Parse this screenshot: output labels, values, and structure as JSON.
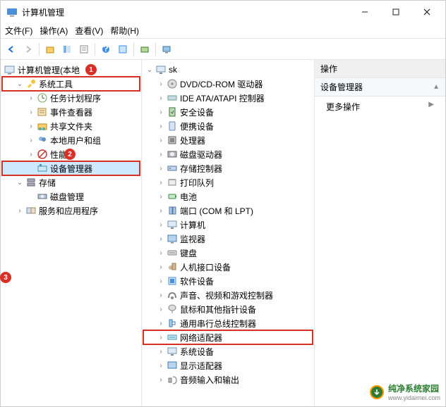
{
  "window": {
    "title": "计算机管理"
  },
  "menu": {
    "file": "文件(F)",
    "action": "操作(A)",
    "view": "查看(V)",
    "help": "帮助(H)"
  },
  "markers": {
    "m1": "1",
    "m2": "2",
    "m3": "3"
  },
  "left_tree": {
    "root": "计算机管理(本地",
    "system_tools": "系统工具",
    "task_scheduler": "任务计划程序",
    "event_viewer": "事件查看器",
    "shared_folders": "共享文件夹",
    "local_users": "本地用户和组",
    "performance": "性能",
    "device_manager": "设备管理器",
    "storage": "存储",
    "disk_management": "磁盘管理",
    "services_apps": "服务和应用程序"
  },
  "mid_tree": {
    "root": "sk",
    "items": [
      "DVD/CD-ROM 驱动器",
      "IDE ATA/ATAPI 控制器",
      "安全设备",
      "便携设备",
      "处理器",
      "磁盘驱动器",
      "存储控制器",
      "打印队列",
      "电池",
      "端口 (COM 和 LPT)",
      "计算机",
      "监视器",
      "键盘",
      "人机接口设备",
      "软件设备",
      "声音、视频和游戏控制器",
      "鼠标和其他指针设备",
      "通用串行总线控制器",
      "网络适配器",
      "系统设备",
      "显示适配器",
      "音频输入和输出"
    ]
  },
  "right": {
    "header": "操作",
    "section": "设备管理器",
    "more": "更多操作"
  },
  "watermark": {
    "text": "纯净系统家园",
    "url": "www.yidaimei.com"
  }
}
